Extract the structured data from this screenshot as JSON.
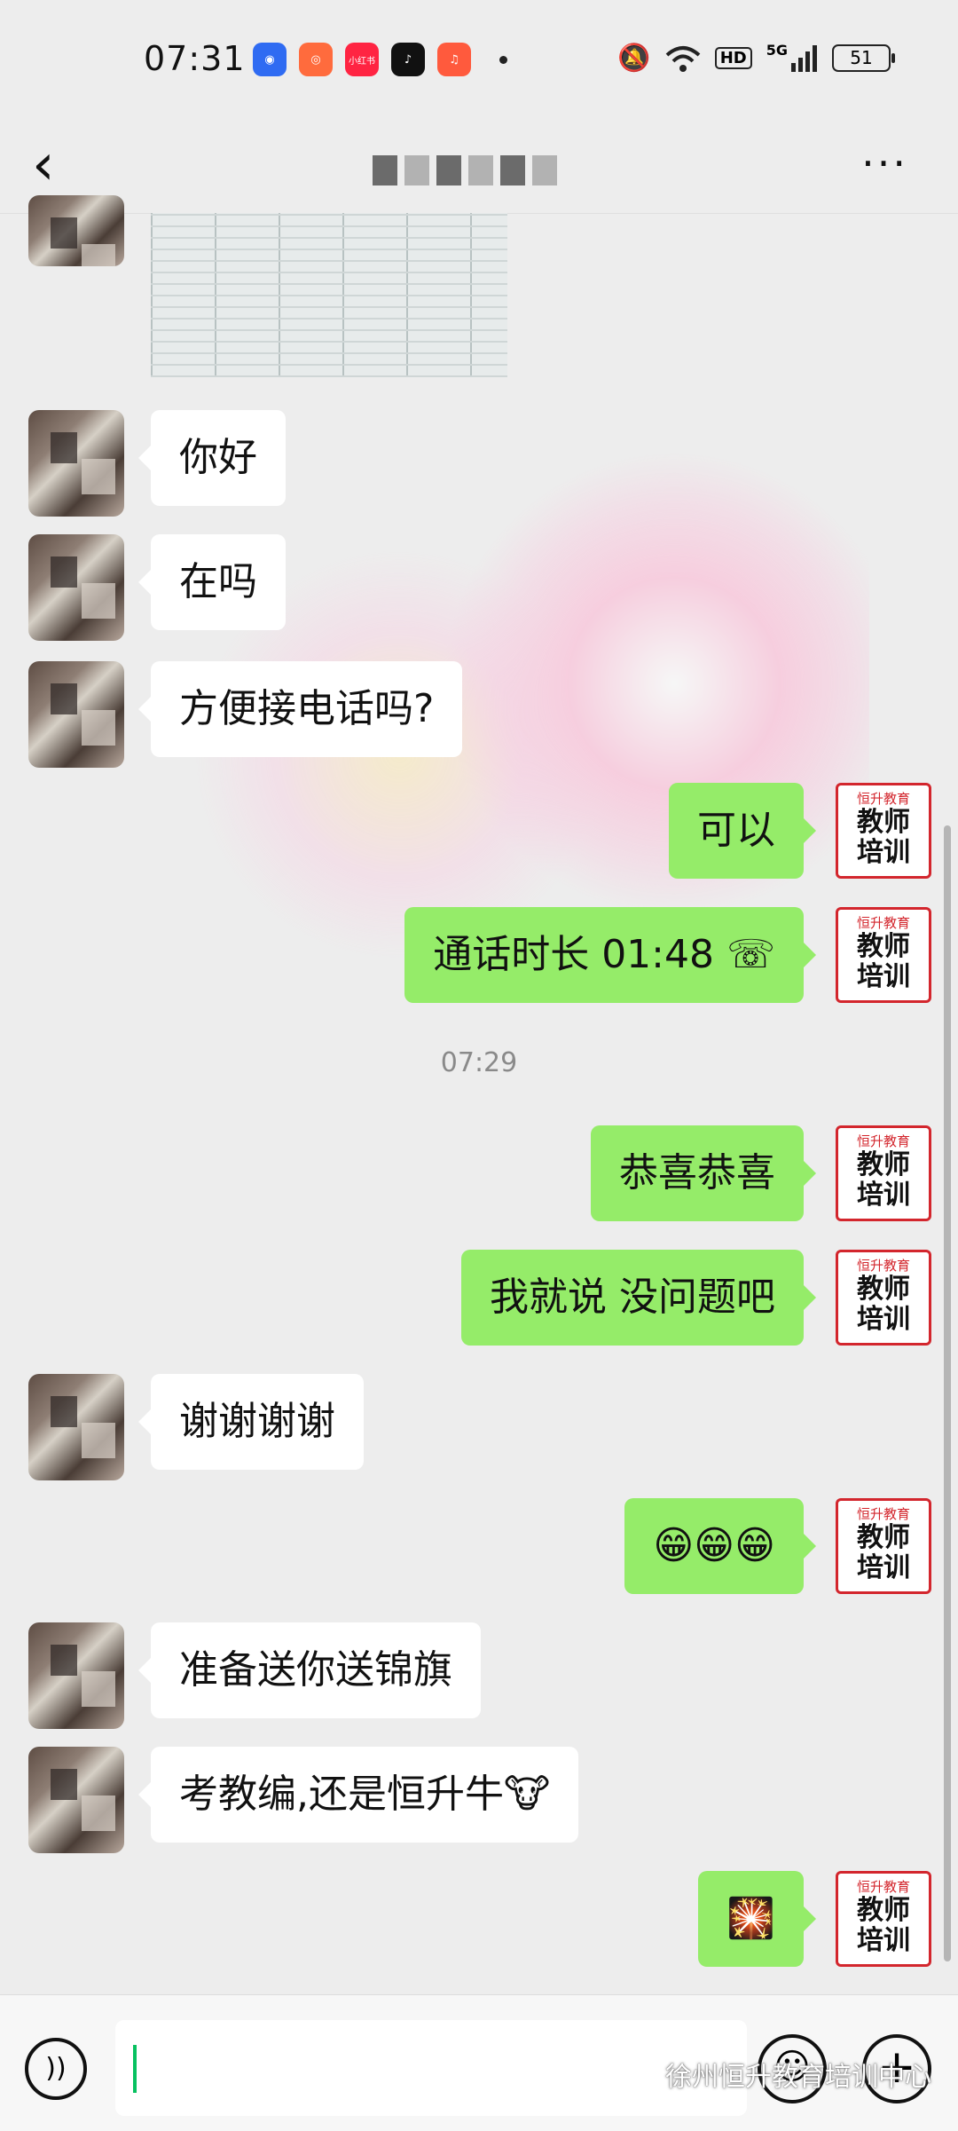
{
  "status_bar": {
    "time": "07:31",
    "apps": [
      {
        "icon": "baidu-icon",
        "color": "#2f6bf2",
        "glyph": "◉"
      },
      {
        "icon": "kuaishou-icon",
        "color": "#ff6b3d",
        "glyph": "◎"
      },
      {
        "icon": "xiaohongshu-icon",
        "color": "#ff2442",
        "glyph": "小红书"
      },
      {
        "icon": "douyin-icon",
        "color": "#111111",
        "glyph": "♪"
      },
      {
        "icon": "music-icon",
        "color": "#ff5a3d",
        "glyph": "♫"
      }
    ],
    "hd_label": "HD",
    "signal_label": "5G",
    "battery": "51"
  },
  "chat": {
    "timestamp": "07:29",
    "messages": [
      {
        "side": "in",
        "text": "你好"
      },
      {
        "side": "in",
        "text": "在吗"
      },
      {
        "side": "in",
        "text": "方便接电话吗?"
      },
      {
        "side": "out",
        "text": "可以"
      },
      {
        "side": "out",
        "text": "通话时长 01:48 ☏"
      },
      {
        "side": "out",
        "text": "恭喜恭喜"
      },
      {
        "side": "out",
        "text": "我就说 没问题吧"
      },
      {
        "side": "in",
        "text": "谢谢谢谢"
      },
      {
        "side": "out",
        "text": "😁😁😁"
      },
      {
        "side": "in",
        "text": "准备送你送锦旗"
      },
      {
        "side": "in",
        "text": "考教编,还是恒升牛🐮"
      },
      {
        "side": "out",
        "text": "🎇"
      }
    ]
  },
  "my_avatar": {
    "small_text": "恒升教育",
    "line1": "教师",
    "line2": "培训"
  },
  "input_bar": {
    "voice_glyph": "))",
    "emoji_glyph": "☺",
    "plus_glyph": "+"
  },
  "watermark": "徐州恒升教育培训中心",
  "colors": {
    "outgoing_bubble": "#95ec69",
    "incoming_bubble": "#ffffff",
    "background": "#ededed"
  }
}
